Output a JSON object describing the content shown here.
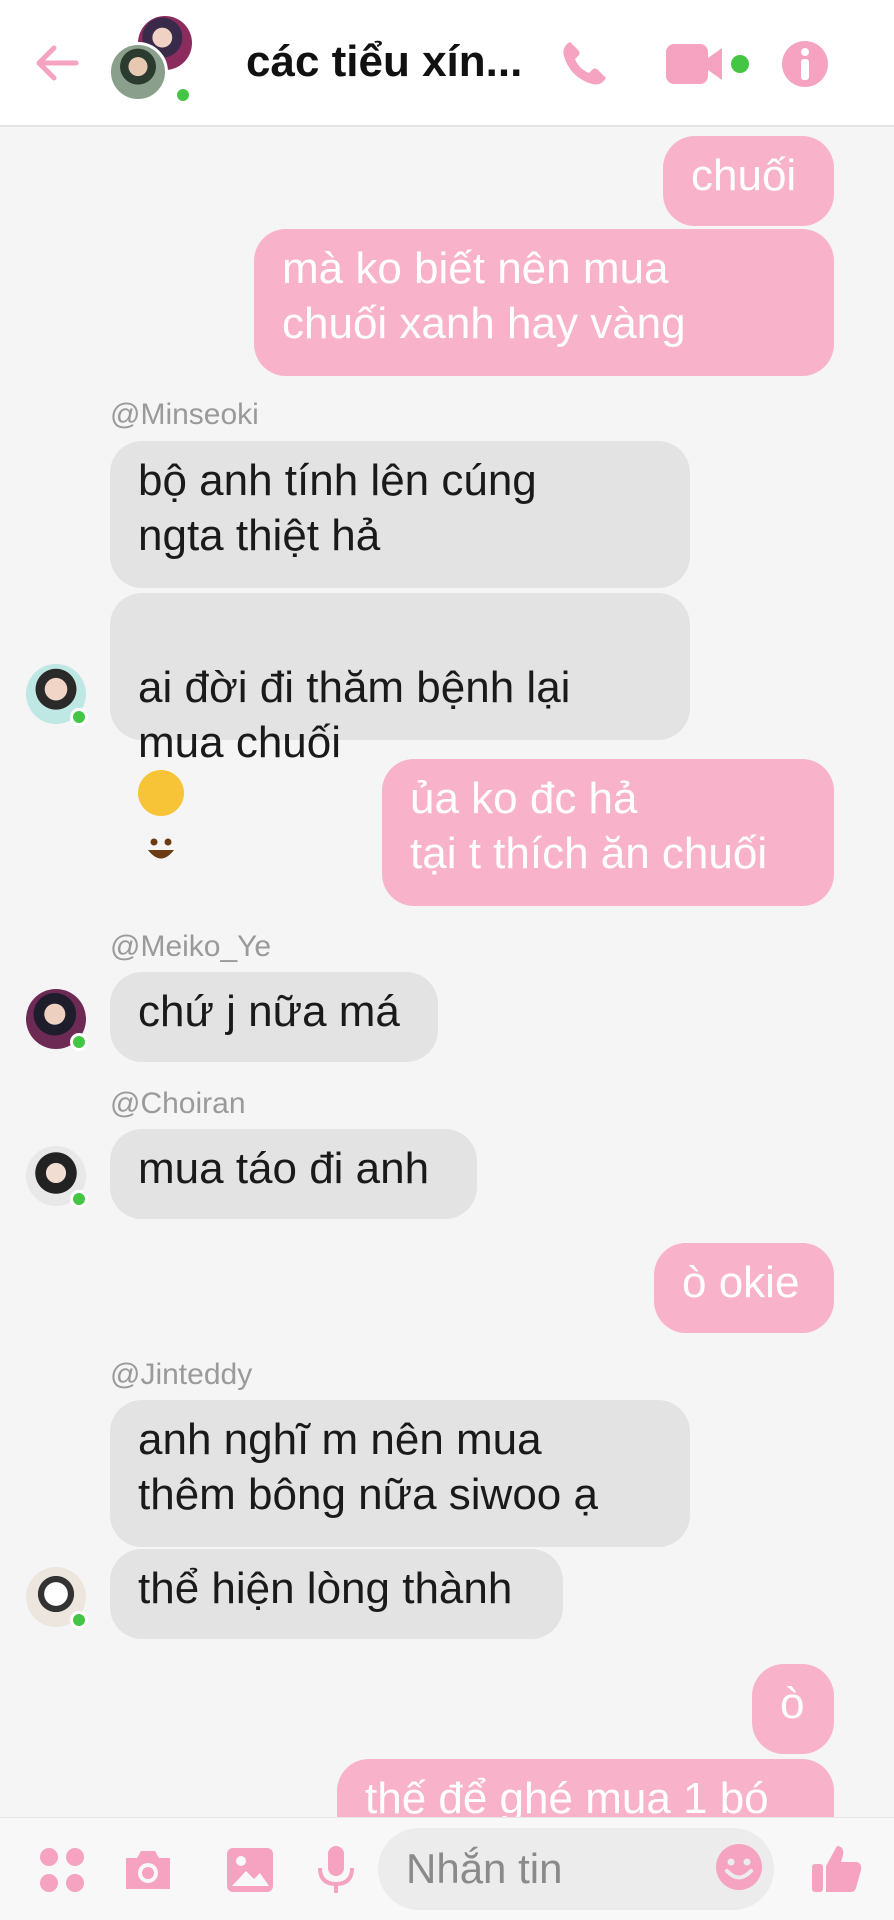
{
  "header": {
    "title": "các tiểu xín...",
    "accent": "#f5a3c0"
  },
  "messages": [
    {
      "dir": "out",
      "text": "chuối"
    },
    {
      "dir": "out",
      "text": "mà ko biết nên mua\nchuối xanh hay vàng"
    },
    {
      "dir": "in",
      "sender": "@Minseoki",
      "text": "bộ anh tính lên cúng\nngta thiệt hả"
    },
    {
      "dir": "in",
      "text": "ai đời đi thăm bệnh lại\nmua chuối",
      "emoji": "grinning-face"
    },
    {
      "dir": "out",
      "text": "ủa ko đc hả\ntại t thích ăn chuối"
    },
    {
      "dir": "in",
      "sender": "@Meiko_Ye",
      "text": "chứ j nữa má"
    },
    {
      "dir": "in",
      "sender": "@Choiran",
      "text": "mua táo đi anh"
    },
    {
      "dir": "out",
      "text": "ò okie"
    },
    {
      "dir": "in",
      "sender": "@Jinteddy",
      "text": "anh nghĩ m nên mua\nthêm bông nữa siwoo ạ"
    },
    {
      "dir": "in",
      "text": "thể hiện lòng thành"
    },
    {
      "dir": "out",
      "text": "ò"
    },
    {
      "dir": "out",
      "text": "thế để ghé mua 1 bó"
    }
  ],
  "composer": {
    "placeholder": "Nhắn tin"
  },
  "colors": {
    "outgoing_bubble": "#f8b3cb",
    "incoming_bubble": "#e3e3e3",
    "online": "#44c543",
    "icon": "#f5a3c0"
  }
}
